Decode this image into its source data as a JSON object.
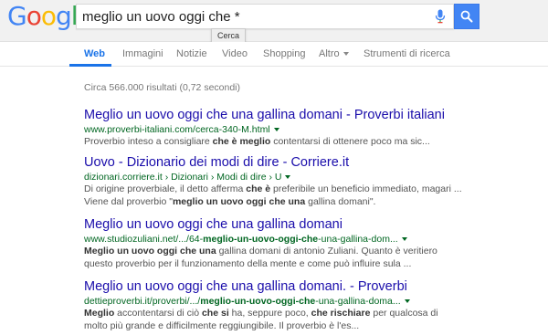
{
  "colors": {
    "logo_blue": "#4285F4",
    "logo_red": "#EA4335",
    "logo_yellow": "#FBBC05",
    "logo_green": "#34A853",
    "link_title": "#1a0dab",
    "url_green": "#006621",
    "accent_blue": "#1a73e8"
  },
  "logo": {
    "letters": [
      "G",
      "o",
      "o",
      "g",
      "l",
      "e"
    ]
  },
  "search": {
    "query": "meglio un uovo oggi che *",
    "tooltip": "Cerca"
  },
  "tabs": [
    {
      "label": "Web",
      "active": true
    },
    {
      "label": "Immagini"
    },
    {
      "label": "Notizie"
    },
    {
      "label": "Video"
    },
    {
      "label": "Shopping"
    },
    {
      "label": "Altro"
    },
    {
      "label": "Strumenti di ricerca"
    }
  ],
  "stats": "Circa 566.000 risultati (0,72 secondi)",
  "results": [
    {
      "title": "Meglio un uovo oggi che una gallina domani - Proverbi italiani",
      "url": [
        "www.proverbi-italiani.com/cerca-340-M.html"
      ],
      "snippet": [
        [
          [
            "Proverbio inteso a consigliare ",
            false
          ],
          [
            "che è meglio",
            true
          ],
          [
            " contentarsi di ottenere poco ma sic...",
            false
          ]
        ]
      ]
    },
    {
      "title": "Uovo - Dizionario dei modi di dire - Corriere.it",
      "url": [
        "dizionari.corriere.it › Dizionari › Modi di dire › U"
      ],
      "snippet": [
        [
          [
            "Di origine proverbiale, il detto afferma ",
            false
          ],
          [
            "che è",
            true
          ],
          [
            " preferibile un beneficio immediato, magari ...",
            false
          ]
        ],
        [
          [
            "Viene dal proverbio \"",
            false
          ],
          [
            "meglio un uovo oggi che una",
            true
          ],
          [
            " gallina domani\".",
            false
          ]
        ]
      ]
    },
    {
      "title": "Meglio un uovo oggi che una gallina domani",
      "url": [
        "www.studiozuliani.net/.../64-",
        "meglio-un-uovo-oggi-che",
        "-una-gallina-dom..."
      ],
      "snippet": [
        [
          [
            "Meglio un uovo oggi che una",
            true
          ],
          [
            " gallina domani di antonio Zuliani. Quanto è veritiero",
            false
          ]
        ],
        [
          [
            "questo proverbio per il funzionamento della mente e come può influire sula ...",
            false
          ]
        ]
      ]
    },
    {
      "title": "Meglio un uovo oggi che una gallina domani. - Proverbi",
      "url": [
        "dettieproverbi.it/proverbi/.../",
        "meglio-un-uovo-oggi-che",
        "-una-gallina-doma..."
      ],
      "snippet": [
        [
          [
            "Meglio",
            true
          ],
          [
            " accontentarsi di ciò ",
            false
          ],
          [
            "che si",
            true
          ],
          [
            " ha, seppure poco, ",
            false
          ],
          [
            "che rischiare",
            true
          ],
          [
            " per qualcosa di",
            false
          ]
        ],
        [
          [
            "molto più grande e difficilmente reggiungibile. Il proverbio è l'es...",
            false
          ]
        ]
      ]
    }
  ]
}
